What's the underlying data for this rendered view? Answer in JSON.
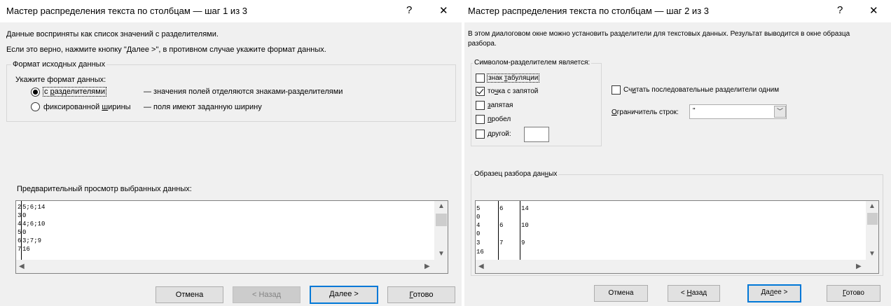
{
  "dialog1": {
    "title": "Мастер распределения текста по столбцам — шаг 1 из 3",
    "help_glyph": "?",
    "close_glyph": "✕",
    "line1": "Данные восприняты как список значений с разделителями.",
    "line2": "Если это верно, нажмите кнопку \"Далее >\", в противном случае укажите формат данных.",
    "group_legend": "Формат исходных данных",
    "format_prompt": "Укажите формат данных:",
    "radio1_label_pre": "с ",
    "radio1_label_u": "р",
    "radio1_label_post": "азделителями",
    "radio1_desc": "— значения полей отделяются знаками-разделителями",
    "radio2_label_pre": "фиксированной ",
    "radio2_label_u": "ш",
    "radio2_label_post": "ирины",
    "radio2_desc": "— поля имеют заданную ширину",
    "preview_label": "Предварительный просмотр выбранных данных:",
    "preview_rows": [
      {
        "num": "2",
        "text": "5;6;14"
      },
      {
        "num": "3",
        "text": "0"
      },
      {
        "num": "4",
        "text": "4;6;10"
      },
      {
        "num": "5",
        "text": "0"
      },
      {
        "num": "6",
        "text": "3;7;9"
      },
      {
        "num": "7",
        "text": "16"
      }
    ],
    "buttons": {
      "cancel": "Отмена",
      "back": "< Назад",
      "next_u": "Д",
      "next_rest": "алее >",
      "finish_u": "Г",
      "finish_rest": "отово"
    }
  },
  "dialog2": {
    "title": "Мастер распределения текста по столбцам — шаг 2 из 3",
    "help_glyph": "?",
    "close_glyph": "✕",
    "intro_line1": "В этом диалоговом окне можно установить разделители для текстовых данных. Результат выводится в окне образца",
    "intro_line2": "разбора.",
    "group_legend": "Символом-разделителем является:",
    "delimiters": {
      "tab": {
        "pre": "знак ",
        "u": "т",
        "post": "абуляции",
        "checked": false
      },
      "semicolon": {
        "pre": "то",
        "u": "ч",
        "post": "ка с запятой",
        "checked": true
      },
      "comma": {
        "pre": "",
        "u": "з",
        "post": "апятая",
        "checked": false
      },
      "space": {
        "pre": "",
        "u": "п",
        "post": "робел",
        "checked": false
      },
      "other": {
        "pre": "",
        "u": "д",
        "post": "ругой:",
        "checked": false,
        "value": ""
      }
    },
    "consecutive": {
      "pre": "Сч",
      "u": "и",
      "post": "тать последовательные разделители одним",
      "checked": false
    },
    "qualifier_label_u": "О",
    "qualifier_label_rest": "граничитель строк:",
    "qualifier_value": "\"",
    "sample_legend_pre": "Образец разбора дан",
    "sample_legend_u": "н",
    "sample_legend_post": "ых",
    "sample_rows": [
      [
        "5",
        "6",
        "14"
      ],
      [
        "0",
        "",
        ""
      ],
      [
        "4",
        "6",
        "10"
      ],
      [
        "0",
        "",
        ""
      ],
      [
        "3",
        "7",
        "9"
      ],
      [
        "16",
        "",
        ""
      ]
    ],
    "buttons": {
      "cancel": "Отмена",
      "back_pre": "< ",
      "back_u": "Н",
      "back_rest": "азад",
      "next_pre": "Да",
      "next_u": "л",
      "next_rest": "ее >",
      "finish_u": "Г",
      "finish_rest": "отово"
    }
  },
  "icons": {
    "scroll_up": "▲",
    "scroll_down": "▼",
    "scroll_left": "◀",
    "scroll_right": "▶",
    "combo_arrow": "﹀"
  }
}
